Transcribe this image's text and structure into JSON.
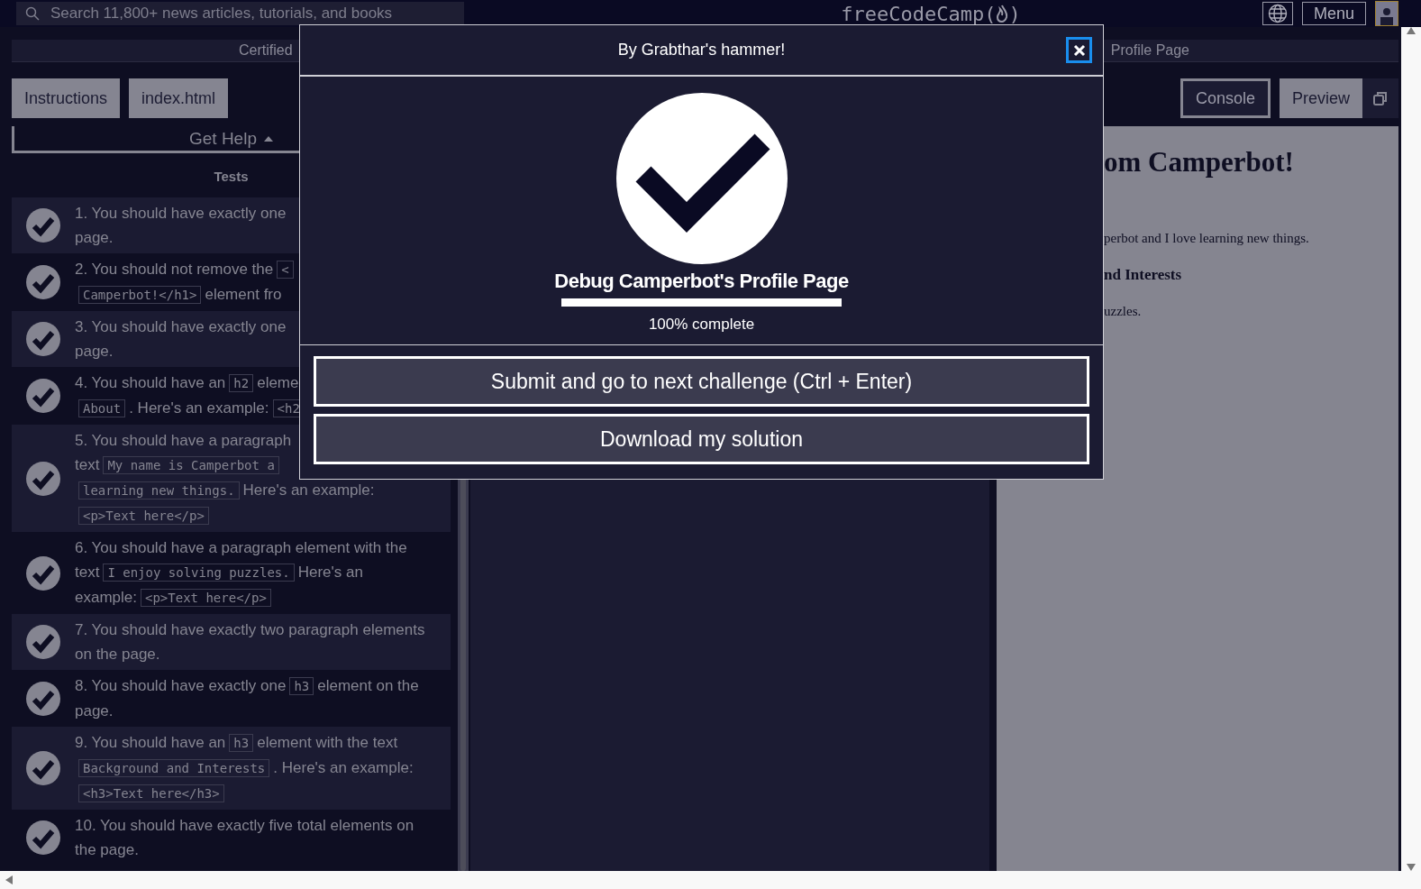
{
  "nav": {
    "search": {
      "placeholder": "Search 11,800+ news articles, tutorials, and books"
    },
    "logo": {
      "name": "freeCodeCamp",
      "open": "(",
      "close": ")"
    },
    "menu": "Menu"
  },
  "breadcrumb": {
    "left": "Certified",
    "right": "Profile Page"
  },
  "tabs_left": [
    {
      "label": "Instructions",
      "selected": false
    },
    {
      "label": "index.html",
      "selected": false
    }
  ],
  "tabs_right": [
    {
      "label": "Console",
      "selected": true
    },
    {
      "label": "Preview",
      "selected": false
    }
  ],
  "get_help": "Get Help",
  "tests_heading": "Tests",
  "tests": [
    {
      "passed": true,
      "lines": [
        [
          {
            "kind": "text",
            "text": "1. You should have exactly one"
          }
        ],
        [
          {
            "kind": "text",
            "text": "page."
          }
        ]
      ]
    },
    {
      "passed": true,
      "lines": [
        [
          {
            "kind": "text",
            "text": "2. You should not remove the"
          },
          {
            "kind": "code",
            "text": "<"
          }
        ],
        [
          {
            "kind": "code",
            "text": "Camperbot!</h1>"
          },
          {
            "kind": "text",
            "text": "element fro"
          }
        ]
      ]
    },
    {
      "passed": true,
      "lines": [
        [
          {
            "kind": "text",
            "text": "3. You should have exactly one"
          }
        ],
        [
          {
            "kind": "text",
            "text": "page."
          }
        ]
      ]
    },
    {
      "passed": true,
      "lines": [
        [
          {
            "kind": "text",
            "text": "4. You should have an"
          },
          {
            "kind": "code",
            "text": "h2"
          },
          {
            "kind": "text",
            "text": "eleme"
          }
        ],
        [
          {
            "kind": "code",
            "text": "About"
          },
          {
            "kind": "text",
            "text": ". Here's an example:"
          },
          {
            "kind": "code",
            "text": "<h2"
          }
        ]
      ]
    },
    {
      "passed": true,
      "lines": [
        [
          {
            "kind": "text",
            "text": "5. You should have a paragraph"
          }
        ],
        [
          {
            "kind": "text",
            "text": "text"
          },
          {
            "kind": "code",
            "text": "My name is Camperbot a"
          }
        ],
        [
          {
            "kind": "code",
            "text": "learning new things."
          },
          {
            "kind": "text",
            "text": "Here's an example:"
          }
        ],
        [
          {
            "kind": "code",
            "text": "<p>Text here</p>"
          }
        ]
      ]
    },
    {
      "passed": true,
      "lines": [
        [
          {
            "kind": "text",
            "text": "6. You should have a paragraph element with the"
          }
        ],
        [
          {
            "kind": "text",
            "text": "text"
          },
          {
            "kind": "code",
            "text": "I enjoy solving puzzles."
          },
          {
            "kind": "text",
            "text": "Here's an"
          }
        ],
        [
          {
            "kind": "text",
            "text": "example:"
          },
          {
            "kind": "code",
            "text": "<p>Text here</p>"
          }
        ]
      ]
    },
    {
      "passed": true,
      "lines": [
        [
          {
            "kind": "text",
            "text": "7. You should have exactly two paragraph elements"
          }
        ],
        [
          {
            "kind": "text",
            "text": "on the page."
          }
        ]
      ]
    },
    {
      "passed": true,
      "lines": [
        [
          {
            "kind": "text",
            "text": "8. You should have exactly one"
          },
          {
            "kind": "code",
            "text": "h3"
          },
          {
            "kind": "text",
            "text": "element on the"
          }
        ],
        [
          {
            "kind": "text",
            "text": "page."
          }
        ]
      ]
    },
    {
      "passed": true,
      "lines": [
        [
          {
            "kind": "text",
            "text": "9. You should have an"
          },
          {
            "kind": "code",
            "text": "h3"
          },
          {
            "kind": "text",
            "text": "element with the text"
          }
        ],
        [
          {
            "kind": "code",
            "text": "Background and Interests"
          },
          {
            "kind": "text",
            "text": ". Here's an example:"
          }
        ],
        [
          {
            "kind": "code",
            "text": "<h3>Text here</h3>"
          }
        ]
      ]
    },
    {
      "passed": true,
      "lines": [
        [
          {
            "kind": "text",
            "text": "10. You should have exactly five total elements on"
          }
        ],
        [
          {
            "kind": "text",
            "text": "the page."
          }
        ]
      ]
    }
  ],
  "preview": {
    "heading": "om Camperbot!",
    "paragraph_1": "perbot and I love learning new things.",
    "subheading": "nd Interests",
    "paragraph_2": "uzzles."
  },
  "modal": {
    "title": "By Grabthar's hammer!",
    "challenge": "Debug Camperbot's Profile Page",
    "progress": {
      "level": 1
    },
    "progress_text": "100% complete",
    "buttons": [
      "Submit and go to next challenge (Ctrl + Enter)",
      "Download my solution"
    ]
  }
}
